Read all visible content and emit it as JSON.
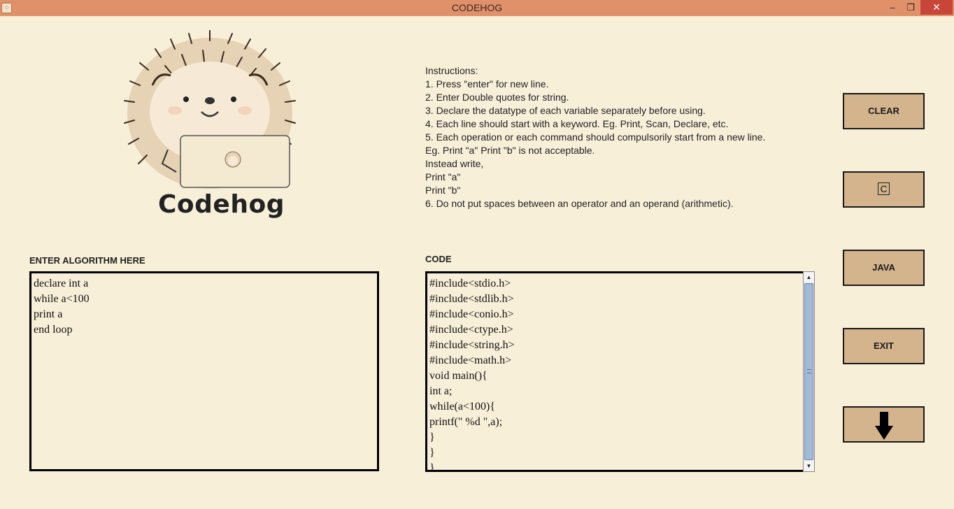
{
  "window": {
    "title": "CODEHOG",
    "controls": {
      "minimize": "–",
      "maximize": "❐",
      "close": "✕"
    }
  },
  "logo": {
    "text": "Codehog",
    "icon": "hedgehog-with-laptop"
  },
  "instructions": {
    "lines": [
      "Instructions:",
      "1. Press \"enter\" for new line.",
      "2. Enter Double quotes for string.",
      "3. Declare the datatype of each variable separately before using.",
      "4. Each line should start with a keyword. Eg. Print, Scan, Declare, etc.",
      "5. Each operation or each command should compulsorily start from a new line.",
      "Eg. Print \"a\" Print \"b\" is not acceptable.",
      "Instead write,",
      "Print \"a\"",
      "Print \"b\"",
      "6. Do not put spaces between an operator and an operand (arithmetic)."
    ]
  },
  "algorithm": {
    "label": "ENTER ALGORITHM HERE",
    "lines": [
      "declare int a",
      "while a<100",
      "print a",
      "end loop"
    ]
  },
  "code": {
    "label": "CODE",
    "lines": [
      "#include<stdio.h>",
      "#include<stdlib.h>",
      "#include<conio.h>",
      "#include<ctype.h>",
      "#include<string.h>",
      "#include<math.h>",
      "void main(){",
      "int a;",
      "while(a<100){",
      "printf(\" %d \",a);",
      "}",
      "}",
      "}"
    ]
  },
  "buttons": {
    "clear": "CLEAR",
    "c": "C",
    "java": "JAVA",
    "exit": "EXIT",
    "download_icon": "down-arrow-icon"
  },
  "colors": {
    "titlebar": "#e0916a",
    "background": "#f8efd9",
    "button": "#d4b48d",
    "close": "#c8453a"
  }
}
